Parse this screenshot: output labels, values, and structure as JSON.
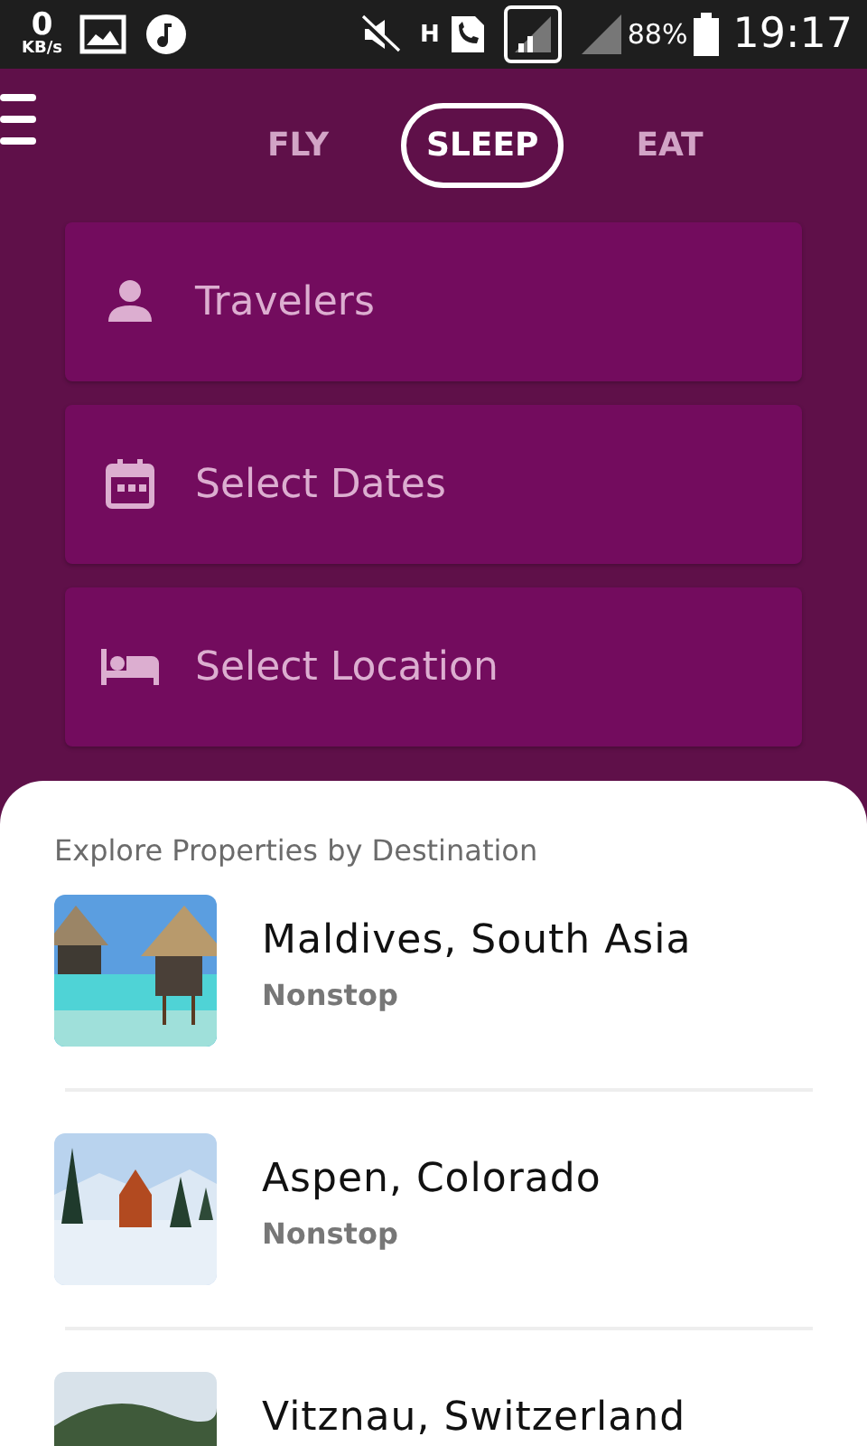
{
  "status_bar": {
    "speed": "0",
    "speed_unit": "KB/s",
    "network": "H",
    "battery": "88%",
    "time": "19:17"
  },
  "tabs": [
    {
      "label": "FLY",
      "selected": false
    },
    {
      "label": "SLEEP",
      "selected": true
    },
    {
      "label": "EAT",
      "selected": false
    }
  ],
  "fields": [
    {
      "kind": "person",
      "placeholder": "Travelers"
    },
    {
      "kind": "calendar",
      "placeholder": "Select Dates"
    },
    {
      "kind": "bed",
      "placeholder": "Select Location"
    }
  ],
  "section_title": "Explore Properties by Destination",
  "destinations": [
    {
      "name": "Maldives, South Asia",
      "subtitle": "Nonstop"
    },
    {
      "name": "Aspen, Colorado",
      "subtitle": "Nonstop"
    },
    {
      "name": "Vitznau, Switzerland"
    }
  ]
}
